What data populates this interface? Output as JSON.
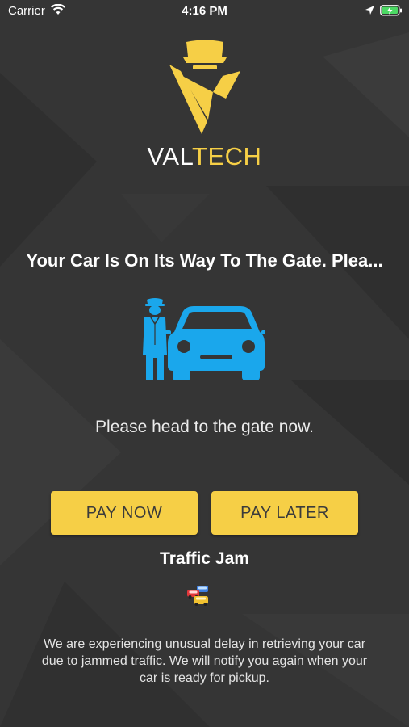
{
  "status_bar": {
    "carrier": "Carrier",
    "time": "4:16 PM",
    "icons": [
      "wifi-icon",
      "location-arrow-icon",
      "battery-charging-icon"
    ]
  },
  "brand": {
    "part1": "VAL",
    "part2": "TECH",
    "logo_icon": "valet-logo-icon"
  },
  "headline": "Your Car Is On Its Way To The Gate.  Plea...",
  "illustration_icon": "valet-with-car-icon",
  "subtitle": "Please head to the gate now.",
  "buttons": {
    "pay_now": "PAY NOW",
    "pay_later": "PAY LATER"
  },
  "status": {
    "title": "Traffic Jam",
    "icon": "traffic-cars-icon",
    "description": "We are experiencing unusual delay in retrieving your car due to jammed traffic. We will notify you again when your car is ready for pickup."
  },
  "colors": {
    "background": "#353535",
    "accent": "#f6cf46",
    "illustration": "#1aa7ec",
    "text": "#ffffff"
  }
}
